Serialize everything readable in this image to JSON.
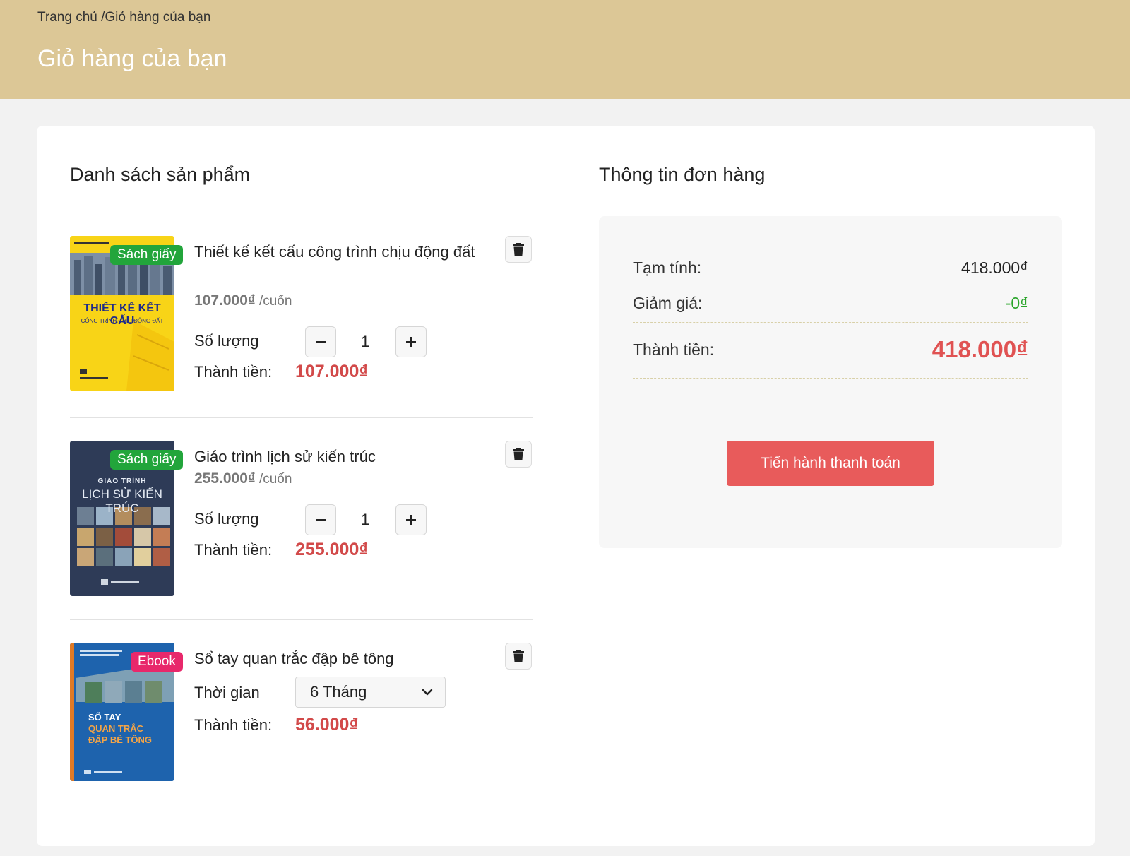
{
  "header": {
    "breadcrumb_home": "Trang chủ",
    "breadcrumb_sep": " /",
    "breadcrumb_current": "Giỏ hàng của bạn",
    "title": "Giỏ hàng của bạn"
  },
  "products": {
    "section_title": "Danh sách sản phẩm",
    "items": [
      {
        "name": "Thiết kế kết cấu công trình chịu động đất",
        "badge": "Sách giấy",
        "unit_price": "107.000₫",
        "unit_suffix": " /cuốn",
        "qty_label": "Số lượng",
        "qty": "1",
        "total_label": "Thành tiền:",
        "total": "107.000₫",
        "cover_title": "THIẾT KẾ KẾT CẤU",
        "cover_subtitle": "CÔNG TRÌNH CHỊU ĐỘNG ĐẤT"
      },
      {
        "name": "Giáo trình lịch sử kiến trúc",
        "badge": "Sách giấy",
        "unit_price": "255.000₫",
        "unit_suffix": " /cuốn",
        "qty_label": "Số lượng",
        "qty": "1",
        "total_label": "Thành tiền:",
        "total": "255.000₫",
        "cover_pretitle": "GIÁO TRÌNH",
        "cover_title": "LỊCH SỬ KIẾN TRÚC"
      },
      {
        "name": "Sổ tay quan trắc đập bê tông",
        "badge": "Ebook",
        "duration_label": "Thời gian",
        "duration_value": "6 Tháng",
        "total_label": "Thành tiền:",
        "total": "56.000₫",
        "cover_line1": "SỔ TAY",
        "cover_line2": "QUAN TRẮC",
        "cover_line3": "ĐẬP BÊ TÔNG"
      }
    ]
  },
  "order": {
    "section_title": "Thông tin đơn hàng",
    "subtotal_label": "Tạm tính:",
    "subtotal": "418.000₫",
    "discount_label": "Giảm giá:",
    "discount": "-0₫",
    "total_label": "Thành tiền:",
    "total": "418.000₫",
    "checkout_label": "Tiến hành thanh toán"
  },
  "colors": {
    "banner": "#dcc796",
    "price_red": "#d24a4a",
    "checkout": "#e85b5b",
    "badge_paper": "#22a53b",
    "badge_ebook": "#e8286b",
    "discount_green": "#2aa52a"
  },
  "icons": {
    "delete": "trash-icon",
    "minus": "minus-icon",
    "plus": "plus-icon",
    "dropdown": "chevron-down-icon"
  }
}
